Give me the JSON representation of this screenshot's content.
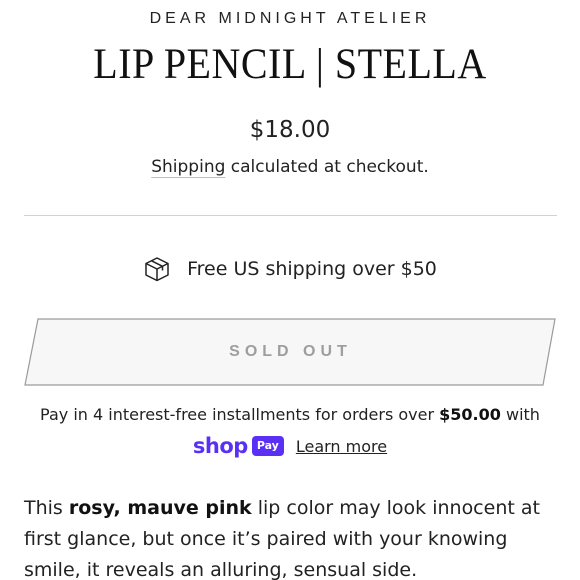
{
  "product": {
    "vendor": "DEAR MIDNIGHT ATELIER",
    "title": "LIP PENCIL | STELLA",
    "price": "$18.00",
    "shipping_link": "Shipping",
    "shipping_rest": " calculated at checkout."
  },
  "perk": {
    "icon": "package-box-icon",
    "text": "Free US shipping over $50"
  },
  "buy_button": {
    "label": "SOLD OUT",
    "state": "disabled"
  },
  "installments": {
    "prefix": "Pay in 4 interest-free installments for orders over ",
    "amount": "$50.00",
    "suffix": " with",
    "brand_word": "shop",
    "brand_badge": "Pay",
    "learn_more": "Learn more",
    "brand_color": "#5a31f4"
  },
  "description": {
    "part1": "This ",
    "bold": "rosy, mauve pink",
    "part2": " lip color may look innocent at first glance, but once it’s paired with your knowing smile, it reveals an alluring, sensual side."
  }
}
